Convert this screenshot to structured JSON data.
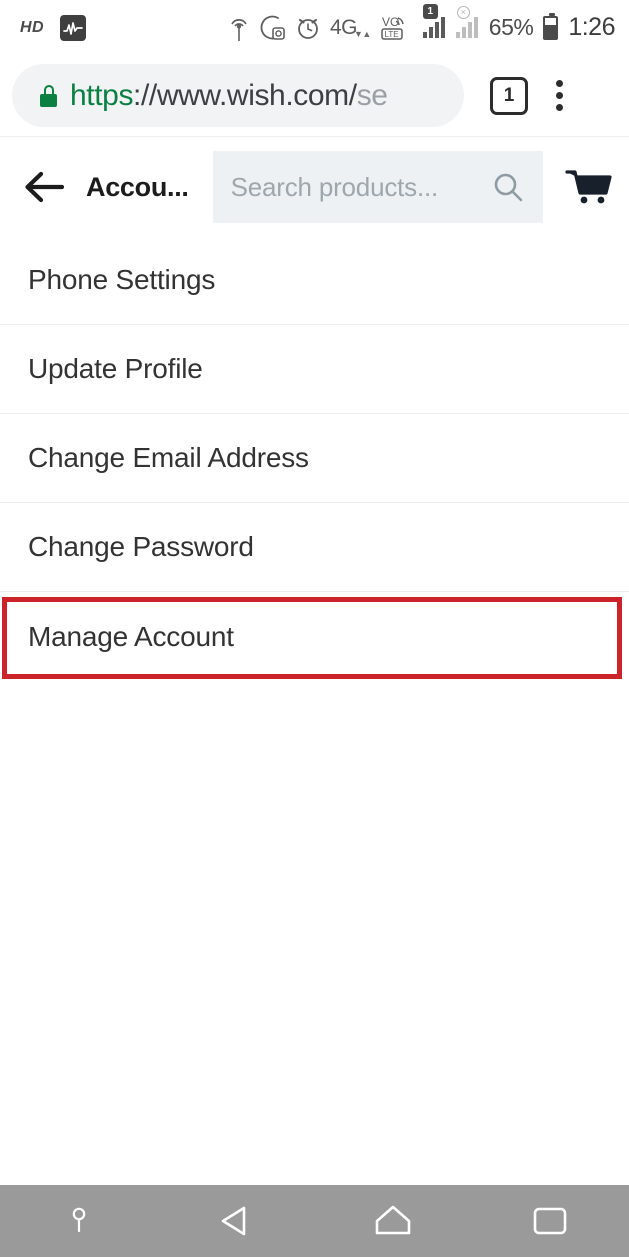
{
  "status_bar": {
    "hd_label": "HD",
    "waveform_icon": "activity-waveform-icon",
    "location_icon": "location-broadcast-icon",
    "dnd_icon": "do-not-disturb-moon-icon",
    "alarm_icon": "alarm-clock-icon",
    "network_type": "4G",
    "data_arrows": "▼▲",
    "volte_label": "VO",
    "lte_label": "LTE",
    "sim_badge": "1",
    "no_service_mark": "×",
    "battery_percent": "65%",
    "time": "1:26"
  },
  "browser": {
    "lock_icon": "secure-lock-icon",
    "url_scheme": "https",
    "url_host": "://www.wish.com/",
    "url_path": "se",
    "tab_count": "1",
    "menu_icon": "kebab-menu-icon"
  },
  "app_header": {
    "back_icon": "back-arrow-icon",
    "title": "Accou...",
    "search_placeholder": "Search products...",
    "search_icon": "search-magnifier-icon",
    "cart_icon": "shopping-cart-icon"
  },
  "menu": {
    "items": [
      {
        "label": "Phone Settings"
      },
      {
        "label": "Update Profile"
      },
      {
        "label": "Change Email Address"
      },
      {
        "label": "Change Password"
      },
      {
        "label": "Manage Account"
      }
    ]
  },
  "highlight": {
    "target_label": "Manage Account",
    "color": "#cc2229"
  },
  "nav_bar": {
    "background": "#9a9a9a",
    "buttons": [
      {
        "name": "keyboard-pin-icon"
      },
      {
        "name": "back-triangle-icon"
      },
      {
        "name": "home-icon"
      },
      {
        "name": "recents-square-icon"
      }
    ]
  }
}
